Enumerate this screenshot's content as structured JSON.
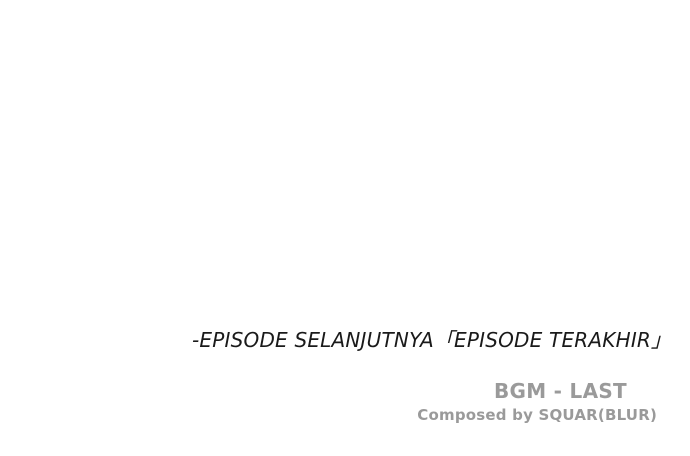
{
  "next_episode_text": "-EPISODE SELANJUTNYA「EPISODE TERAKHIR」",
  "credits": {
    "bgm": "BGM - LAST",
    "composer": "Composed by SQUAR(BLUR)"
  },
  "colors": {
    "background": "#ffffff",
    "primary_text": "#1a1a1a",
    "credit_text": "#9a9a9a"
  }
}
